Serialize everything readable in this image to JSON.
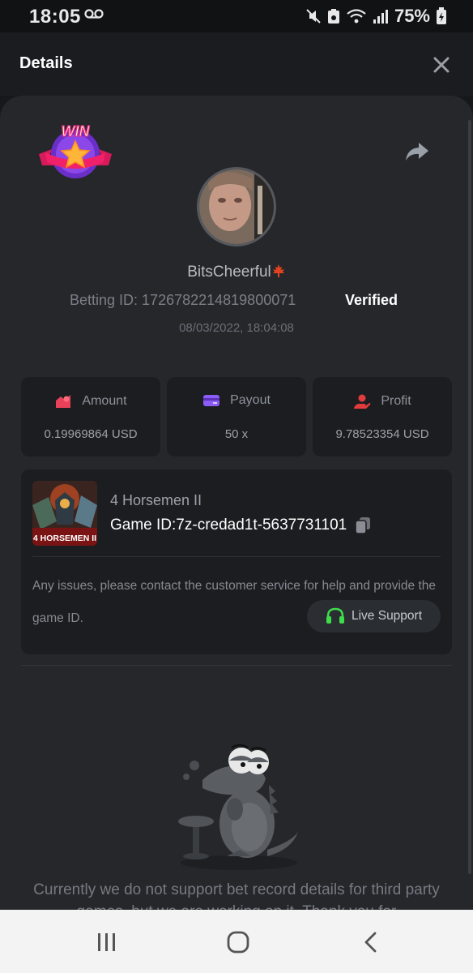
{
  "status_bar": {
    "time": "18:05",
    "battery": "75%"
  },
  "header": {
    "title": "Details"
  },
  "bet": {
    "username": "BitsCheerful",
    "betting_id": "Betting ID: 1726782214819800071",
    "verified_label": "Verified",
    "datetime": "08/03/2022, 18:04:08"
  },
  "stats": {
    "amount": {
      "label": "Amount",
      "value": "0.19969864 USD"
    },
    "payout": {
      "label": "Payout",
      "value": "50 x"
    },
    "profit": {
      "label": "Profit",
      "value": "9.78523354 USD"
    }
  },
  "game": {
    "name": "4 Horsemen II",
    "thumb_text": "4 HORSEMEN II",
    "game_id": "Game ID:7z-credad1t-5637731101",
    "notice": "Any issues, please contact the customer service for help and provide the game ID.",
    "live_support_label": "Live Support"
  },
  "badge_text": "WIN",
  "info_text": "Currently we do not support bet record details for third party games, but we are working on it. Thank you for",
  "colors": {
    "amount_icon": "#e8425a",
    "payout_icon": "#8b5cf6",
    "profit_icon": "#e23b3b",
    "live_support_icon": "#3ddc4a"
  }
}
